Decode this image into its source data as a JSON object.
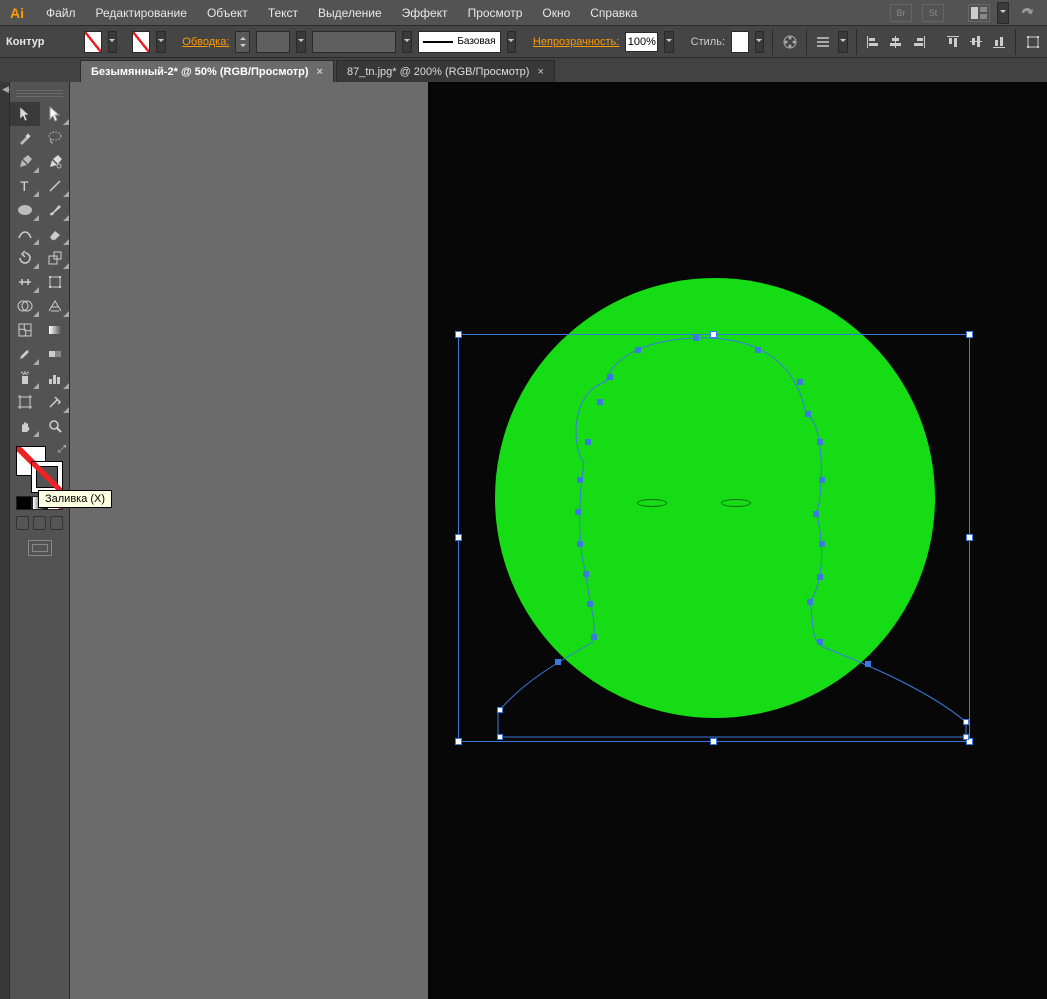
{
  "app": {
    "logo": "Ai"
  },
  "menu": {
    "items": [
      "Файл",
      "Редактирование",
      "Объект",
      "Текст",
      "Выделение",
      "Эффект",
      "Просмотр",
      "Окно",
      "Справка"
    ],
    "right_icons": [
      "Br",
      "St"
    ]
  },
  "control": {
    "object_label": "Контур",
    "stroke_label": "Обводка:",
    "stroke_style_label": "Базовая",
    "opacity_label": "Непрозрачность:",
    "opacity_value": "100%",
    "style_label": "Стиль:"
  },
  "tabs": [
    {
      "label": "Безымянный-2* @ 50% (RGB/Просмотр)",
      "active": true
    },
    {
      "label": "87_tn.jpg* @ 200% (RGB/Просмотр)",
      "active": false
    }
  ],
  "tooltip": "Заливка (X)",
  "colors": {
    "shape_fill": "#16dc16",
    "selection": "#3a7ae0"
  }
}
